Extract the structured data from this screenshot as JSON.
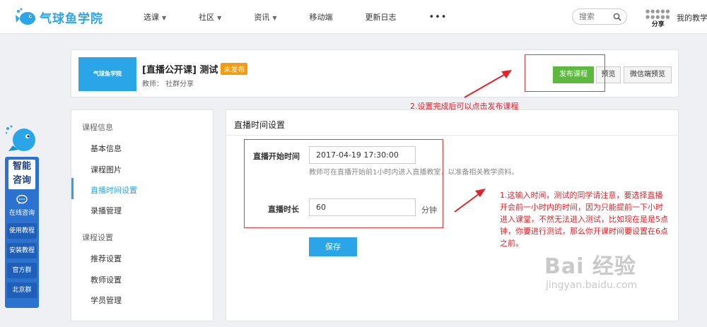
{
  "nav": {
    "logo_text": "气球鱼学院",
    "items": [
      {
        "label": "选课",
        "dropdown": true
      },
      {
        "label": "社区",
        "dropdown": true
      },
      {
        "label": "资讯",
        "dropdown": true
      },
      {
        "label": "移动端",
        "dropdown": false
      },
      {
        "label": "更新日志",
        "dropdown": false
      }
    ],
    "more_label": "•••",
    "search_placeholder": "搜索",
    "share_label": "分享",
    "mine_label": "我的教学"
  },
  "side_widget": {
    "title_line1": "智能",
    "title_line2": "咨询",
    "online_label": "在线咨询",
    "buttons": [
      "使用教程",
      "安装教程",
      "官方群",
      "北京群"
    ]
  },
  "course": {
    "thumb_text": "气球鱼学院",
    "title": "[直播公开课] 测试",
    "status_badge": "未发布",
    "teacher": "教师： 社群分享",
    "publish_label": "发布课程",
    "preview_label": "预览",
    "wx_preview_label": "微信端预览"
  },
  "left_menu": {
    "group1": "课程信息",
    "group1_items": [
      "基本信息",
      "课程图片",
      "直播时间设置",
      "录播管理"
    ],
    "group2": "课程设置",
    "group2_items": [
      "推荐设置",
      "教师设置",
      "学员管理"
    ]
  },
  "form": {
    "section_title": "直播时间设置",
    "start_label": "直播开始时间",
    "start_value": "2017-04-19 17:30:00",
    "start_hint": "教师可在直播开始前1小时内进入直播教室，以准备相关教学资料。",
    "duration_label": "直播时长",
    "duration_value": "60",
    "duration_unit": "分钟",
    "save_label": "保存"
  },
  "annotations": {
    "note2": "2.设置完成后可以点击发布课程",
    "note1_lines": [
      "1.这输入时间，测试的同学请注意，要选择直播",
      "开会前一小时内的时间，因为只能提前一下小时",
      "进入课堂，不然无法进入测试，比如现在是是5点",
      "钟，你要进行测试，那么你开课时间要设置在6点",
      "之前。"
    ]
  },
  "watermark": {
    "brand": "Bai 经验",
    "url": "jingyan.baidu.com"
  },
  "colors": {
    "brand_blue": "#2aa6e8",
    "publish_green": "#5cb83e",
    "badge_orange": "#f39c12",
    "annotation_red": "#e0242a",
    "side_panel_blue": "#2c73d0"
  }
}
